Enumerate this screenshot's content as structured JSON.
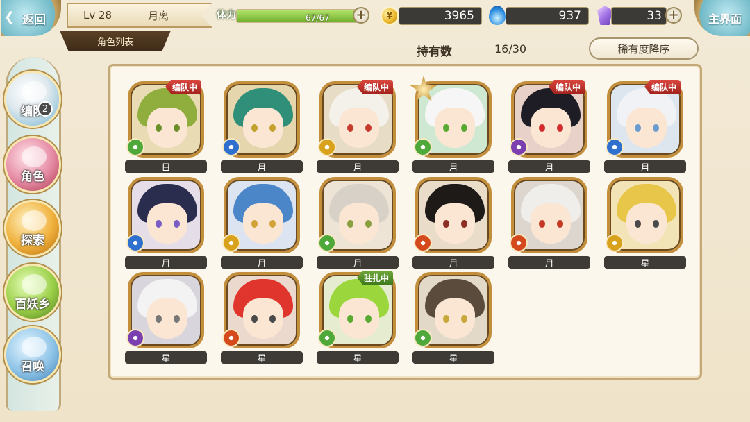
{
  "header": {
    "back_label": "返回",
    "level": "Lv 28",
    "player_name": "月离",
    "list_tab": "角色列表",
    "stamina_label": "体力",
    "stamina_text": "67/67",
    "stamina_fraction": 1.0,
    "gold": "3965",
    "soul": "937",
    "crystal": "33",
    "home_label": "主界面"
  },
  "roster": {
    "count_label": "持有数",
    "count_value": "16/30",
    "sort_label": "稀有度降序"
  },
  "nav": [
    {
      "label": "编队",
      "icon": "ghost-squad-icon",
      "badge": "2"
    },
    {
      "label": "角色",
      "icon": "character-icon"
    },
    {
      "label": "探索",
      "icon": "explore-scroll-icon"
    },
    {
      "label": "百妖乡",
      "icon": "village-hut-icon"
    },
    {
      "label": "召唤",
      "icon": "summon-swirl-icon"
    }
  ],
  "colors": {
    "portrait_frame": "#c38f3c",
    "tag_red": "#c2342d",
    "tag_green": "#5a9430",
    "element_green": "#4ea83a",
    "element_blue": "#2f6fce",
    "element_gold": "#d9a21c",
    "element_purple": "#7b3fb0",
    "element_red": "#d44a1c"
  },
  "characters": [
    {
      "name": "日",
      "tag": "编队中",
      "element": "green-swirl-icon"
    },
    {
      "name": "月",
      "tag": "",
      "element": "blue-swirl-icon"
    },
    {
      "name": "月",
      "tag": "编队中",
      "element": "gold-swirl-icon"
    },
    {
      "name": "月",
      "tag": "",
      "element": "green-swirl-icon"
    },
    {
      "name": "月",
      "tag": "编队中",
      "element": "purple-swirl-icon"
    },
    {
      "name": "月",
      "tag": "编队中",
      "element": "blue-swirl-icon"
    },
    {
      "name": "月",
      "tag": "",
      "element": "blue-swirl-icon"
    },
    {
      "name": "月",
      "tag": "",
      "element": "gold-swirl-icon"
    },
    {
      "name": "月",
      "tag": "",
      "element": "green-swirl-icon"
    },
    {
      "name": "月",
      "tag": "",
      "element": "red-swirl-icon"
    },
    {
      "name": "月",
      "tag": "",
      "element": "red-swirl-icon"
    },
    {
      "name": "星",
      "tag": "",
      "element": "gold-swirl-icon"
    },
    {
      "name": "星",
      "tag": "",
      "element": "purple-swirl-icon"
    },
    {
      "name": "星",
      "tag": "",
      "element": "red-swirl-icon"
    },
    {
      "name": "星",
      "tag": "驻扎中",
      "element": "green-swirl-icon"
    },
    {
      "name": "星",
      "tag": "",
      "element": "green-swirl-icon"
    }
  ]
}
